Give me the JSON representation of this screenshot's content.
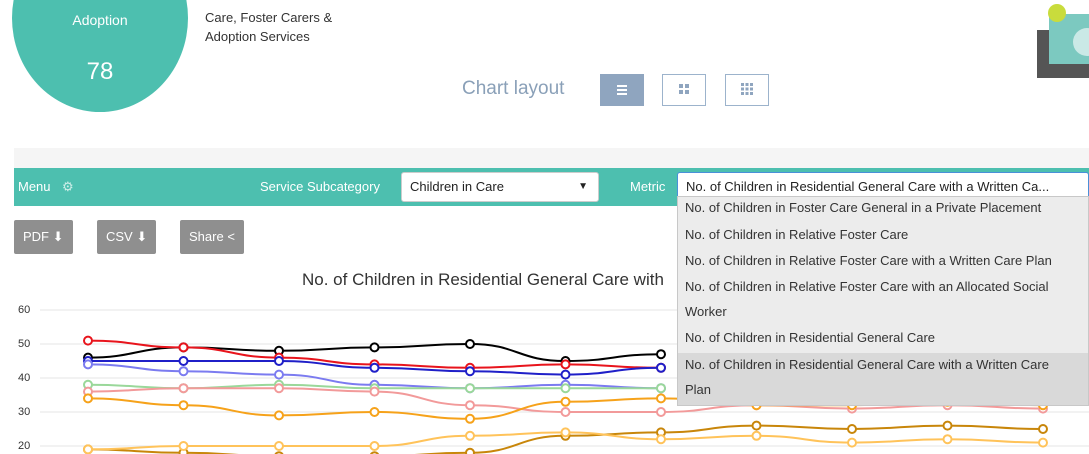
{
  "header": {
    "adoption_label": "Adoption",
    "adoption_count": "78",
    "category_text": [
      "Care, Foster Carers &",
      "Adoption Services"
    ],
    "chart_layout_label": "Chart layout",
    "layout_buttons": [
      "list-icon",
      "grid-2-icon",
      "grid-3-icon"
    ]
  },
  "toolbar": {
    "menu_label": "Menu",
    "service_subcategory_label": "Service Subcategory",
    "service_subcategory_value": "Children in Care",
    "metric_label": "Metric",
    "metric_value": "No. of Children in Residential General Care with a Written Ca..."
  },
  "actions": {
    "pdf": "PDF",
    "csv": "CSV",
    "share": "Share"
  },
  "metric_dropdown": {
    "options": [
      "No. of Children in Foster Care General in a Private Placement",
      "No. of Children in Relative Foster Care",
      "No. of Children in Relative Foster Care with a Written Care Plan",
      "No. of Children in Relative Foster Care with an Allocated Social",
      "Worker",
      "No. of Children in Residential General Care",
      "No. of Children in Residential General Care with a Written Care",
      "Plan"
    ],
    "selected_index": 6
  },
  "colors": {
    "accent": "#4dbfaf",
    "layout_button": "#8fa5bf",
    "export_button": "#8f8f8f"
  },
  "chart_data": {
    "type": "line",
    "title": "No. of Children in Residential General Care with",
    "ylim": [
      18,
      63
    ],
    "yticks": [
      "60",
      "50",
      "40",
      "30",
      "20"
    ],
    "grid": true,
    "series": [
      {
        "color": "#000000",
        "values": [
          46,
          49,
          48,
          49,
          50,
          45,
          47
        ]
      },
      {
        "color": "#e8141c",
        "values": [
          51,
          49,
          46,
          44,
          43,
          44,
          43
        ]
      },
      {
        "color": "#1f1fc8",
        "values": [
          45,
          45,
          45,
          43,
          42,
          41,
          43
        ]
      },
      {
        "color": "#7b7bf0",
        "values": [
          44,
          42,
          41,
          38,
          37,
          38,
          37
        ]
      },
      {
        "color": "#9ad89a",
        "values": [
          38,
          37,
          38,
          37,
          37,
          37,
          37
        ]
      },
      {
        "color": "#f29a9a",
        "values": [
          36,
          37,
          37,
          36,
          32,
          30,
          30,
          32,
          31,
          32,
          31
        ]
      },
      {
        "color": "#f6a21a",
        "values": [
          34,
          32,
          29,
          30,
          28,
          33,
          34,
          32,
          32,
          33,
          32
        ]
      },
      {
        "color": "#c8860a",
        "values": [
          19,
          18,
          17,
          17,
          18,
          23,
          24,
          26,
          25,
          26,
          25
        ]
      },
      {
        "color": "#ffc35a",
        "values": [
          19,
          20,
          20,
          20,
          23,
          24,
          22,
          23,
          21,
          22,
          21
        ]
      }
    ]
  }
}
